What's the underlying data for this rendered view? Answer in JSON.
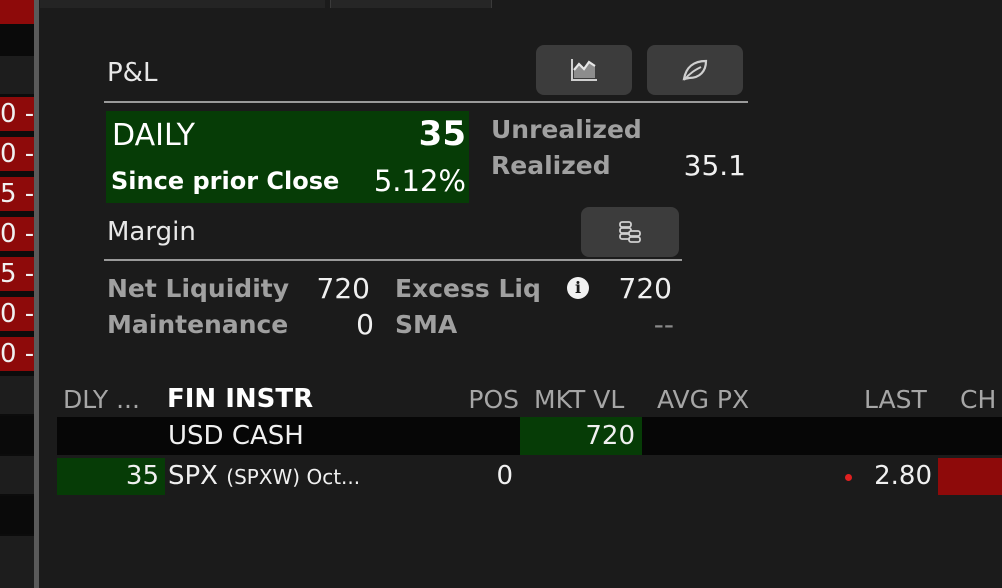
{
  "pnl": {
    "title": "P&L",
    "daily_label": "DAILY",
    "daily_value": "35",
    "since_label": "Since prior Close",
    "since_value": "5.12%",
    "unrealized_label": "Unrealized",
    "unrealized_value": "",
    "realized_label": "Realized",
    "realized_value": "35.1",
    "buttons": [
      {
        "icon": "area-chart-icon"
      },
      {
        "icon": "leaf-icon"
      }
    ]
  },
  "margin": {
    "title": "Margin",
    "button_icon": "coins-stack-icon",
    "net_liquidity_label": "Net Liquidity",
    "net_liquidity_value": "720",
    "excess_liq_label": "Excess Liq",
    "excess_liq_value": "720",
    "maintenance_label": "Maintenance",
    "maintenance_value": "0",
    "sma_label": "SMA",
    "sma_value": "--"
  },
  "table": {
    "columns": {
      "dly": "DLY ...",
      "fin_instr": "FIN INSTR",
      "pos": "POS",
      "mkt_vl": "MKT VL",
      "avg_px": "AVG PX",
      "last": "LAST",
      "chg": "CH"
    },
    "rows": [
      {
        "dly": "",
        "instrument": "USD CASH",
        "pos": "",
        "mkt_vl": "720",
        "avg_px": "",
        "last": ""
      },
      {
        "dly": "35",
        "instrument": "SPX",
        "instrument_sub": "(SPXW) Oct...",
        "pos": "0",
        "mkt_vl": "",
        "avg_px": "",
        "last": "2.80"
      }
    ]
  },
  "left_strip": [
    "0 -",
    "0 -",
    "5 -",
    "0 -",
    "5 -",
    "0 -",
    "0 -"
  ],
  "colors": {
    "background": "#1b1b1b",
    "positive": "#063c06",
    "negative": "#8e0a0a",
    "muted_label": "#a0a0a0"
  }
}
